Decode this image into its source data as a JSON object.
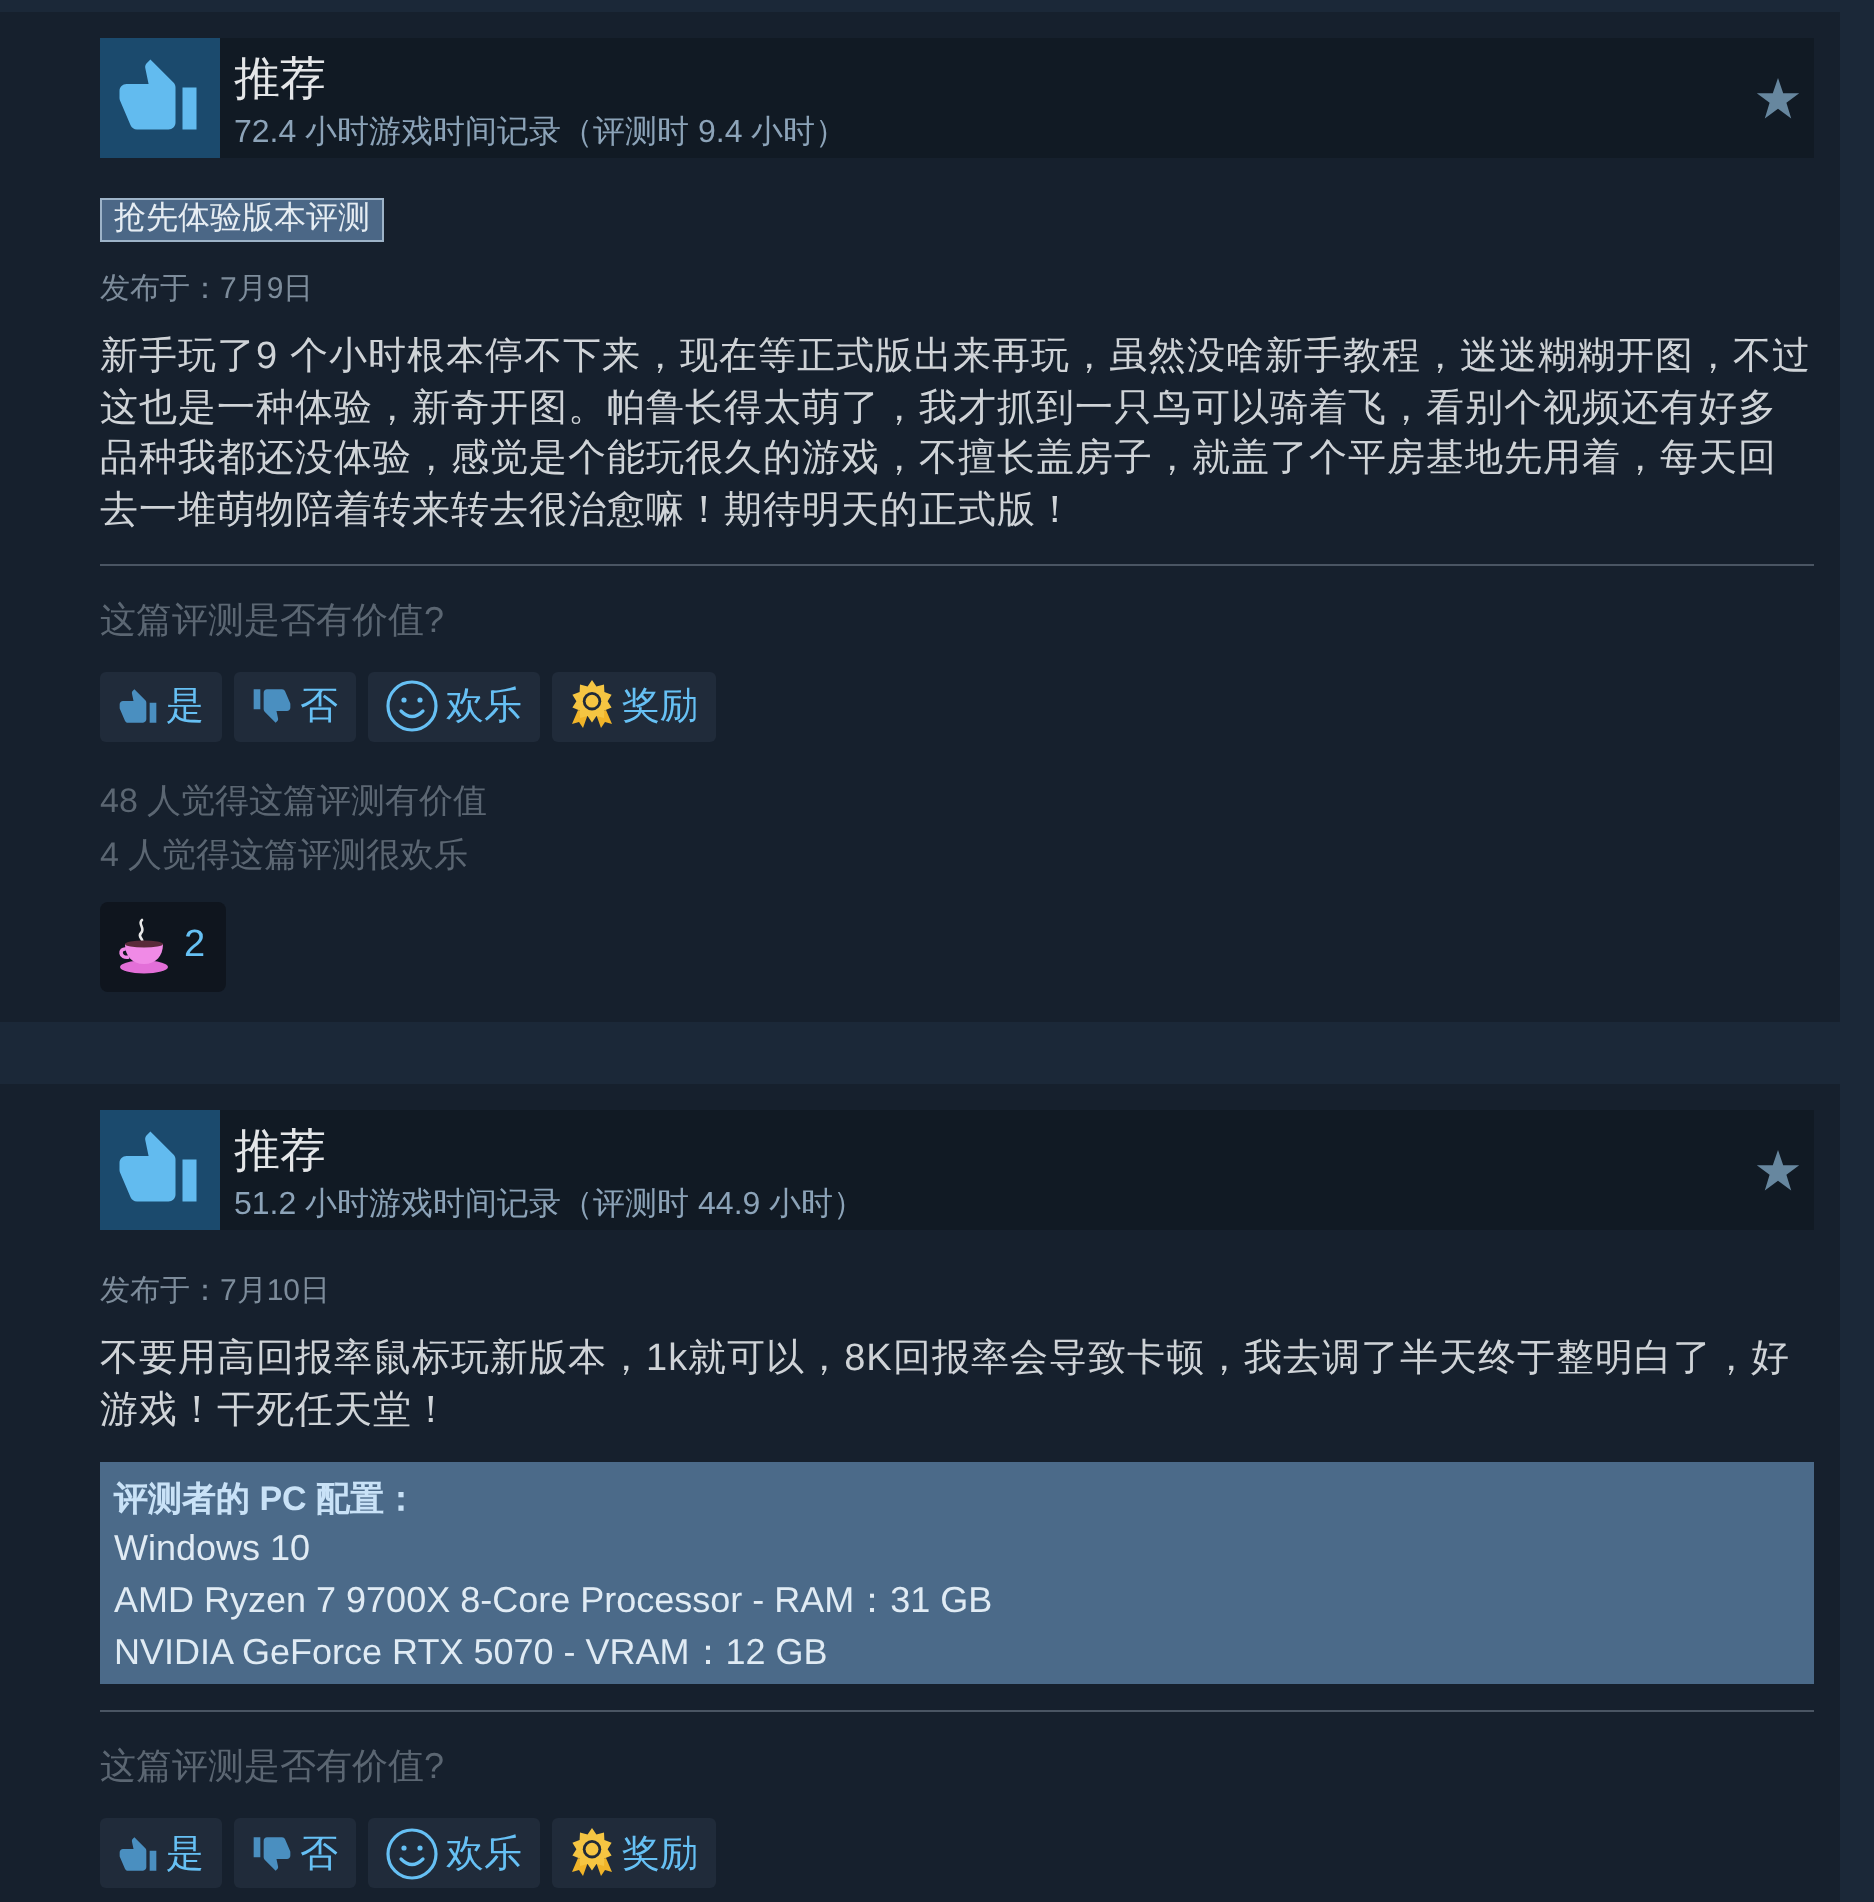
{
  "reviews": [
    {
      "verdict": "推荐",
      "hours": "72.4 小时游戏时间记录（评测时 9.4 小时）",
      "badge": "抢先体验版本评测",
      "posted": "发布于：7月9日",
      "text": "新手玩了9 个小时根本停不下来，现在等正式版出来再玩，虽然没啥新手教程，迷迷糊糊开图，不过这也是一种体验，新奇开图。帕鲁长得太萌了，我才抓到一只鸟可以骑着飞，看别个视频还有好多品种我都还没体验，感觉是个能玩很久的游戏，不擅长盖房子，就盖了个平房基地先用着，每天回去一堆萌物陪着转来转去很治愈嘛！期待明天的正式版！",
      "helpful_prompt": "这篇评测是否有价值?",
      "vote_buttons": [
        {
          "kind": "yes",
          "label": "是"
        },
        {
          "kind": "no",
          "label": "否"
        },
        {
          "kind": "funny",
          "label": "欢乐"
        },
        {
          "kind": "award",
          "label": "奖励"
        }
      ],
      "stats": [
        "48 人觉得这篇评测有价值",
        "4 人觉得这篇评测很欢乐"
      ],
      "awards": [
        {
          "kind": "teacup",
          "count": "2"
        }
      ]
    },
    {
      "verdict": "推荐",
      "hours": "51.2 小时游戏时间记录（评测时 44.9 小时）",
      "posted": "发布于：7月10日",
      "text": "不要用高回报率鼠标玩新版本，1k就可以，8K回报率会导致卡顿，我去调了半天终于整明白了，好游戏！干死任天堂！",
      "pc_specs": {
        "title": "评测者的 PC 配置：",
        "lines": [
          "Windows 10",
          "AMD Ryzen 7 9700X 8-Core Processor - RAM：31 GB",
          "NVIDIA GeForce RTX 5070 - VRAM：12 GB"
        ]
      },
      "helpful_prompt": "这篇评测是否有价值?",
      "vote_buttons": [
        {
          "kind": "yes",
          "label": "是"
        },
        {
          "kind": "no",
          "label": "否"
        },
        {
          "kind": "funny",
          "label": "欢乐"
        },
        {
          "kind": "award",
          "label": "奖励"
        }
      ]
    }
  ]
}
